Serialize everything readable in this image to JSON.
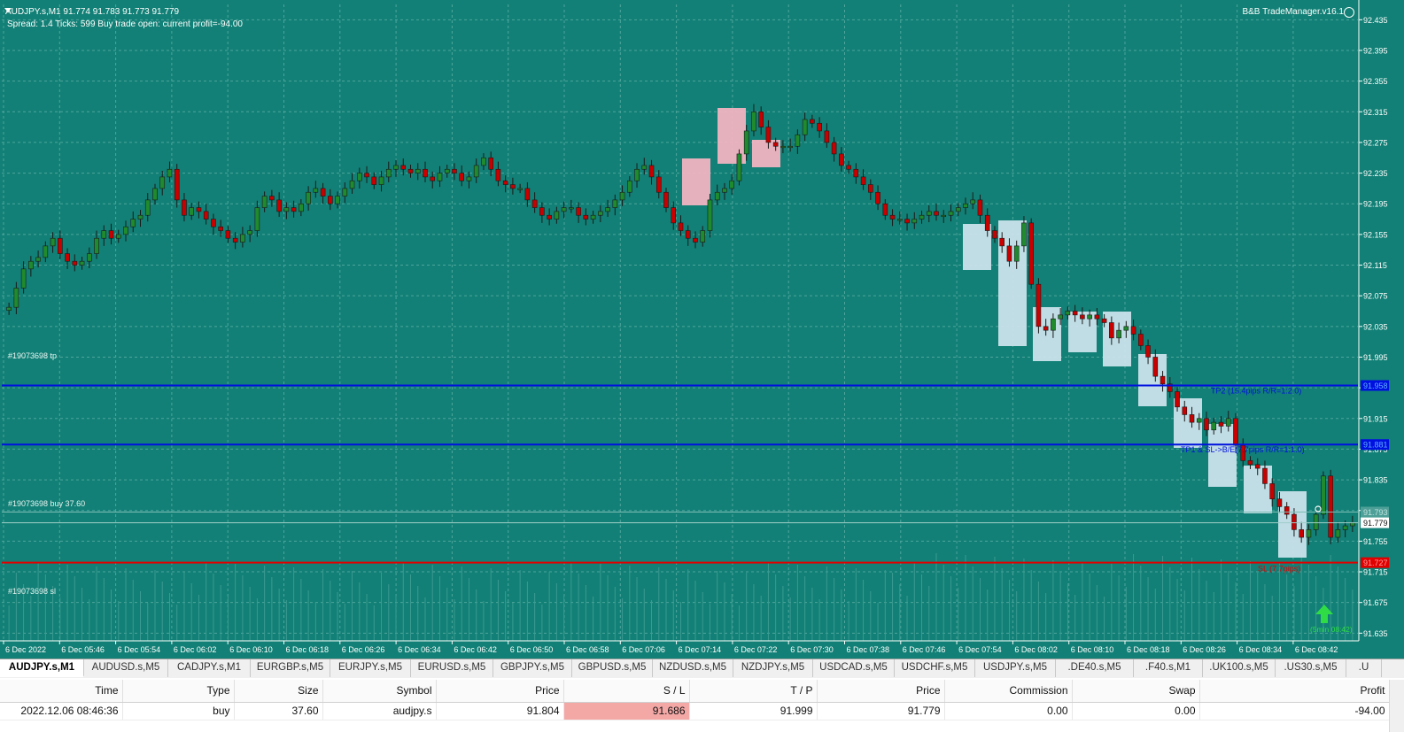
{
  "header": {
    "symbol_line": "AUDJPY.s,M1  91.774 91.783 91.773 91.779",
    "spread_line": "Spread: 1.4   Ticks: 599   Buy trade open: current profit=-94.00",
    "trade_manager": "B&B TradeManager.v16.1"
  },
  "order_labels": {
    "tp": "#19073698 tp",
    "buy": "#19073698 buy 37.60",
    "sl": "#19073698 sl"
  },
  "chart_data": {
    "type": "candlestick",
    "symbol": "AUDJPY.s",
    "timeframe": "M1",
    "y_range": [
      91.625,
      92.455
    ],
    "y_ticks": [
      "92.435",
      "92.395",
      "92.355",
      "92.315",
      "92.275",
      "92.235",
      "92.195",
      "92.155",
      "92.115",
      "92.075",
      "92.035",
      "91.995",
      "91.955",
      "91.915",
      "91.875",
      "91.835",
      "91.795",
      "91.755",
      "91.715",
      "91.675",
      "91.635"
    ],
    "x_ticks": [
      "6 Dec 2022",
      "6 Dec 05:46",
      "6 Dec 05:54",
      "6 Dec 06:02",
      "6 Dec 06:10",
      "6 Dec 06:18",
      "6 Dec 06:26",
      "6 Dec 06:34",
      "6 Dec 06:42",
      "6 Dec 06:50",
      "6 Dec 06:58",
      "6 Dec 07:06",
      "6 Dec 07:14",
      "6 Dec 07:22",
      "6 Dec 07:30",
      "6 Dec 07:38",
      "6 Dec 07:46",
      "6 Dec 07:54",
      "6 Dec 08:02",
      "6 Dec 08:10",
      "6 Dec 08:18",
      "6 Dec 08:26",
      "6 Dec 08:34",
      "6 Dec 08:42"
    ],
    "closes": [
      92.06,
      92.085,
      92.11,
      92.12,
      92.125,
      92.14,
      92.15,
      92.13,
      92.12,
      92.115,
      92.12,
      92.13,
      92.15,
      92.16,
      92.15,
      92.155,
      92.165,
      92.175,
      92.18,
      92.2,
      92.215,
      92.23,
      92.24,
      92.2,
      92.18,
      92.19,
      92.185,
      92.175,
      92.165,
      92.16,
      92.15,
      92.145,
      92.155,
      92.16,
      92.19,
      92.205,
      92.2,
      92.185,
      92.19,
      92.185,
      92.195,
      92.21,
      92.215,
      92.205,
      92.195,
      92.205,
      92.215,
      92.225,
      92.235,
      92.23,
      92.22,
      92.23,
      92.24,
      92.245,
      92.24,
      92.235,
      92.24,
      92.23,
      92.225,
      92.235,
      92.24,
      92.235,
      92.225,
      92.23,
      92.245,
      92.255,
      92.24,
      92.225,
      92.22,
      92.215,
      92.215,
      92.2,
      92.19,
      92.18,
      92.175,
      92.185,
      92.19,
      92.19,
      92.18,
      92.175,
      92.18,
      92.185,
      92.19,
      92.2,
      92.21,
      92.225,
      92.24,
      92.245,
      92.23,
      92.21,
      92.19,
      92.17,
      92.16,
      92.15,
      92.145,
      92.16,
      92.2,
      92.21,
      92.215,
      92.225,
      92.26,
      92.29,
      92.315,
      92.295,
      92.275,
      92.27,
      92.27,
      92.27,
      92.285,
      92.305,
      92.3,
      92.29,
      92.275,
      92.26,
      92.245,
      92.24,
      92.23,
      92.22,
      92.21,
      92.195,
      92.18,
      92.175,
      92.175,
      92.17,
      92.175,
      92.18,
      92.185,
      92.18,
      92.18,
      92.185,
      92.19,
      92.195,
      92.2,
      92.18,
      92.16,
      92.15,
      92.14,
      92.12,
      92.14,
      92.17,
      92.09,
      92.035,
      92.03,
      92.045,
      92.05,
      92.055,
      92.05,
      92.045,
      92.05,
      92.045,
      92.04,
      92.02,
      92.03,
      92.035,
      92.025,
      92.01,
      91.995,
      91.97,
      91.96,
      91.95,
      91.93,
      91.92,
      91.91,
      91.915,
      91.9,
      91.91,
      91.905,
      91.915,
      91.88,
      91.86,
      91.855,
      91.85,
      91.83,
      91.81,
      91.8,
      91.79,
      91.77,
      91.76,
      91.77,
      91.79,
      91.84,
      91.76,
      91.77,
      91.775,
      91.779
    ],
    "levels": [
      {
        "label": "TP2 (15.4pips R/R=1:2.0)",
        "price": 91.958,
        "color": "#0010e0"
      },
      {
        "label": "TP1 & SL->B/E(7.7pips R/R=1:1.0)",
        "price": 91.881,
        "color": "#0010e0"
      },
      {
        "label": "SL (7.7pips)",
        "price": 91.727,
        "color": "#e00000"
      },
      {
        "label": "",
        "price": 91.793,
        "color": "#7dbdb6"
      },
      {
        "label": "",
        "price": 91.779,
        "color": "#9fcfc9"
      }
    ],
    "price_tags": {
      "tp2": "91.958",
      "tp1": "91.881",
      "bid": "91.779",
      "ask": "91.793",
      "sl": "91.727"
    },
    "arrow_label": "(5min 08:42)",
    "colors": {
      "bull": "#1f8a2e",
      "bear": "#c80000",
      "grid": "#4fa59d",
      "background": "#128076"
    }
  },
  "tabs": [
    "AUDJPY.s,M1",
    "AUDUSD.s,M5",
    "CADJPY.s,M1",
    "EURGBP.s,M5",
    "EURJPY.s,M5",
    "EURUSD.s,M5",
    "GBPJPY.s,M5",
    "GBPUSD.s,M5",
    "NZDUSD.s,M5",
    "NZDJPY.s,M5",
    "USDCAD.s,M5",
    "USDCHF.s,M5",
    "USDJPY.s,M5",
    ".DE40.s,M5",
    ".F40.s,M1",
    ".UK100.s,M5",
    ".US30.s,M5",
    ".U"
  ],
  "trade_table": {
    "headers": [
      "Time",
      "Type",
      "Size",
      "Symbol",
      "Price",
      "S / L",
      "T / P",
      "Price",
      "Commission",
      "Swap",
      "Profit"
    ],
    "rows": [
      [
        "2022.12.06 08:46:36",
        "buy",
        "37.60",
        "audjpy.s",
        "91.804",
        "91.686",
        "91.999",
        "91.779",
        "0.00",
        "0.00",
        "-94.00"
      ]
    ]
  }
}
